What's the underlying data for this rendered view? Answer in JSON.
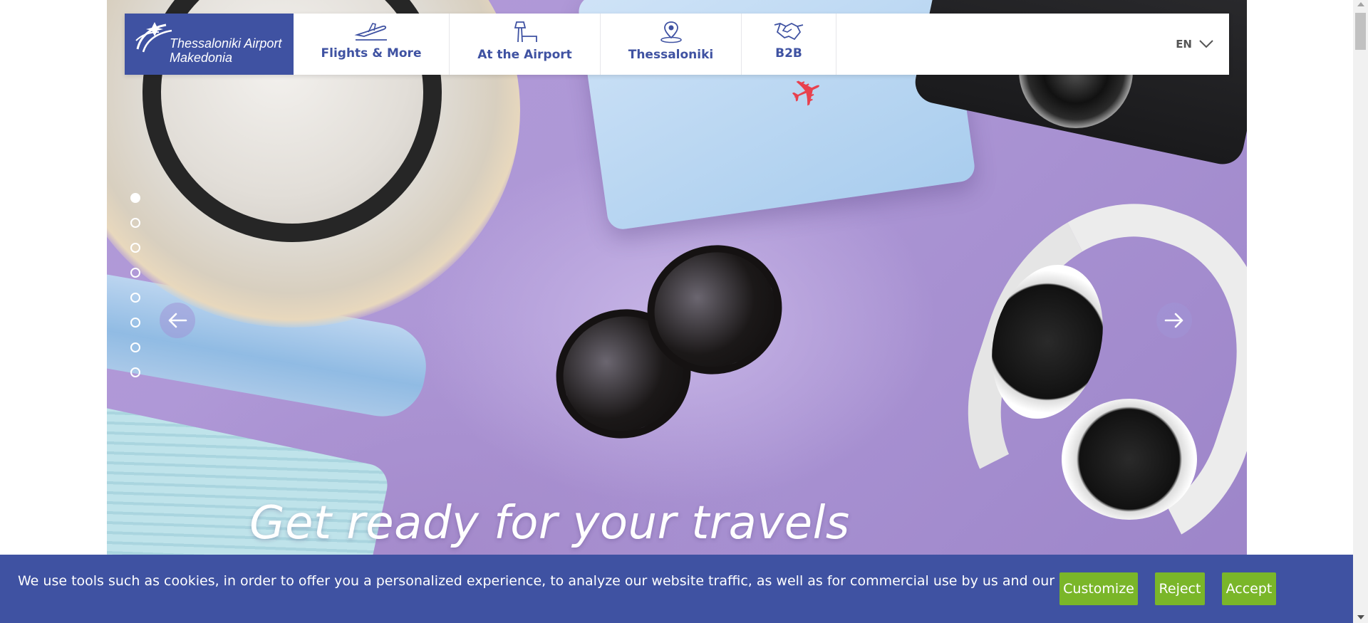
{
  "header": {
    "logo": {
      "line1": "Thessaloniki Airport",
      "line2": "Makedonia"
    },
    "nav": [
      {
        "label": "Flights & More",
        "icon": "airplane-takeoff-icon"
      },
      {
        "label": "At the Airport",
        "icon": "control-tower-icon"
      },
      {
        "label": "Thessaloniki",
        "icon": "map-pin-icon"
      },
      {
        "label": "B2B",
        "icon": "handshake-icon"
      }
    ],
    "language": {
      "value": "EN",
      "icon": "chevron-down-icon"
    }
  },
  "hero": {
    "headline": "Get ready for your travels",
    "slides_count": 8,
    "active_slide": 1,
    "prev_icon": "arrow-left-icon",
    "next_icon": "arrow-right-icon"
  },
  "cookie_banner": {
    "text": "We use tools such as cookies, in order to offer you a personalized experience, to analyze our website traffic, as well as for commercial use by us and our partners.",
    "buttons": {
      "customize": "Customize",
      "reject": "Reject",
      "accept": "Accept"
    }
  },
  "colors": {
    "brand_blue": "#3f52a2",
    "accept_green": "#7ab629",
    "hero_purple": "#ad97d6"
  }
}
